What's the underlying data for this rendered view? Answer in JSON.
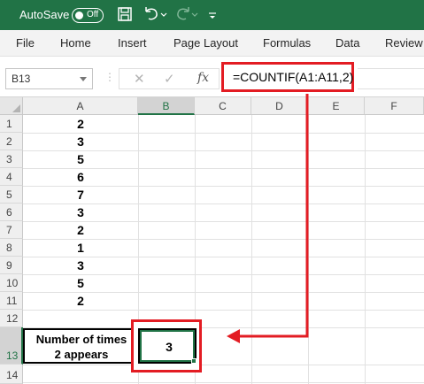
{
  "titlebar": {
    "autosave_label": "AutoSave",
    "autosave_state": "Off"
  },
  "ribbon": {
    "tabs": [
      "File",
      "Home",
      "Insert",
      "Page Layout",
      "Formulas",
      "Data",
      "Review"
    ]
  },
  "formula_bar": {
    "name_box": "B13",
    "formula": "=COUNTIF(A1:A11,2)"
  },
  "columns": [
    "A",
    "B",
    "C",
    "D",
    "E",
    "F"
  ],
  "rows": [
    "1",
    "2",
    "3",
    "4",
    "5",
    "6",
    "7",
    "8",
    "9",
    "10",
    "11",
    "12",
    "13",
    "14"
  ],
  "cells": {
    "a_values": [
      "2",
      "3",
      "5",
      "6",
      "7",
      "3",
      "2",
      "1",
      "3",
      "5",
      "2"
    ],
    "a13_line1": "Number of times",
    "a13_line2": "2 appears",
    "b13": "3"
  },
  "colors": {
    "excel_green": "#217346",
    "highlight_red": "#e31c23"
  }
}
